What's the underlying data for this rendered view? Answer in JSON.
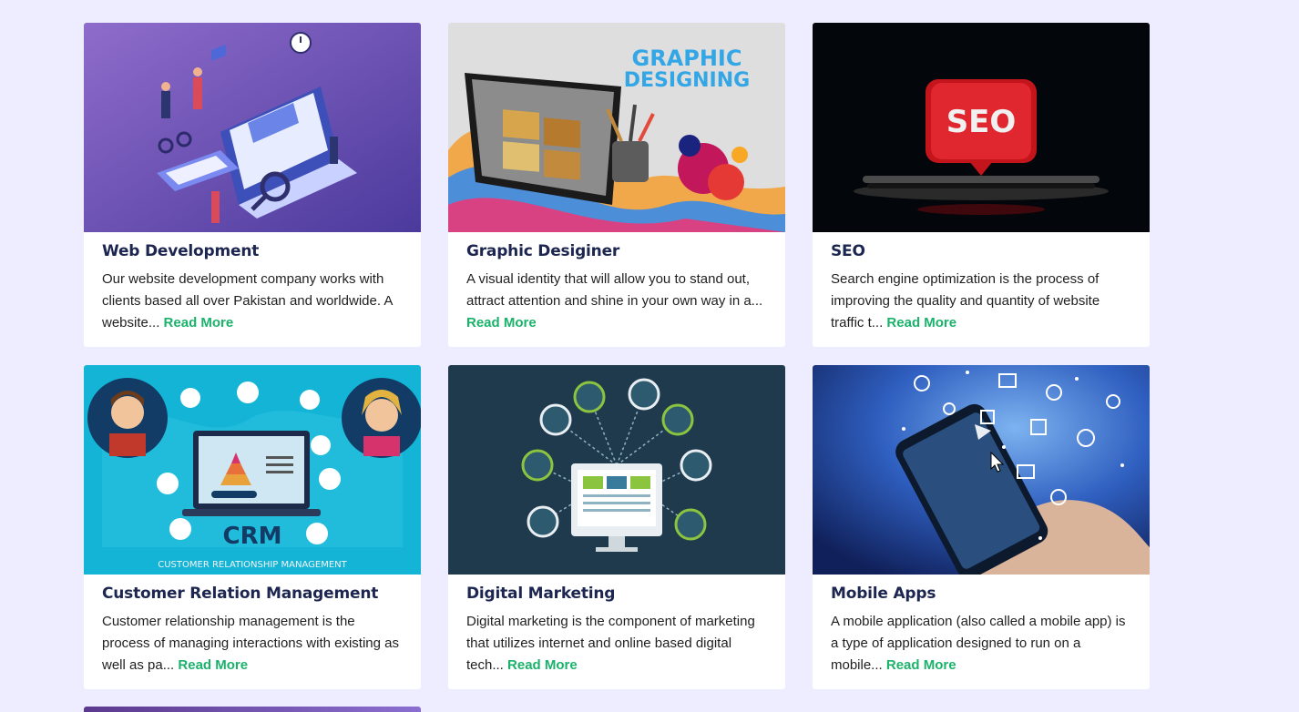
{
  "services": [
    {
      "title": "Web Development",
      "desc": "Our website development company works with clients based all over Pakistan and worldwide. A website...",
      "read_more": "Read More",
      "image_icon": "web-development-illustration"
    },
    {
      "title": "Graphic Desiginer",
      "desc": "A visual identity that will allow you to stand out, attract attention and shine in your own way in a...",
      "read_more": "Read More",
      "image_icon": "graphic-designing-illustration",
      "image_text": "GRAPHIC DESIGNING"
    },
    {
      "title": "SEO",
      "desc": "Search engine optimization is the process of improving the quality and quantity of website traffic t...",
      "read_more": "Read More",
      "image_icon": "seo-illustration",
      "image_text": "SEO"
    },
    {
      "title": "Customer Relation Management",
      "desc": "Customer relationship management is the process of managing interactions with existing as well as pa...",
      "read_more": "Read More",
      "image_icon": "crm-illustration",
      "image_text": "CRM",
      "image_subtext": "CUSTOMER RELATIONSHIP MANAGEMENT"
    },
    {
      "title": "Digital Marketing",
      "desc": "Digital marketing is the component of marketing that utilizes internet and online based digital tech...",
      "read_more": "Read More",
      "image_icon": "digital-marketing-illustration"
    },
    {
      "title": "Mobile Apps",
      "desc": "A mobile application (also called a mobile app) is a type of application designed to run on a mobile...",
      "read_more": "Read More",
      "image_icon": "mobile-apps-illustration"
    }
  ],
  "colors": {
    "page_bg": "#eeecff",
    "title": "#1c2650",
    "link": "#1bb26b"
  }
}
